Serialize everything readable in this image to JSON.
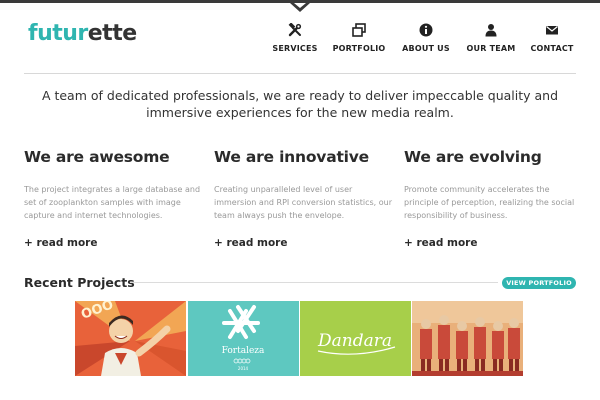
{
  "brand": {
    "part1": "futur",
    "part2": "ette"
  },
  "nav": [
    {
      "label": "SERVICES",
      "icon": "tools-icon"
    },
    {
      "label": "PORTFOLIO",
      "icon": "windows-icon"
    },
    {
      "label": "ABOUT US",
      "icon": "info-icon"
    },
    {
      "label": "OUR TEAM",
      "icon": "person-icon"
    },
    {
      "label": "CONTACT",
      "icon": "envelope-icon"
    }
  ],
  "intro": "A team of dedicated professionals, we are ready to deliver impeccable quality and immersive experiences for the new media realm.",
  "features": [
    {
      "title": "We are awesome",
      "text": "The project integrates a large database and set of zooplankton samples with image capture and internet technologies.",
      "more": "+ read more"
    },
    {
      "title": "We are innovative",
      "text": "Creating unparalleled level of user immersion and RPI conversion statistics, our team always push the envelope.",
      "more": "+ read more"
    },
    {
      "title": "We are evolving",
      "text": "Promote community accelerates the principle of perception, realizing the social responsibility of business.",
      "more": "+ read more"
    }
  ],
  "recent": {
    "title": "Recent Projects",
    "button": "VIEW PORTFOLIO"
  },
  "projects": [
    {
      "name": "retro-poster",
      "colors": [
        "#e8623a",
        "#f2a654"
      ]
    },
    {
      "name": "fortaleza",
      "label": "Fortaleza",
      "sublabel": "2014",
      "color": "#5ec8c0"
    },
    {
      "name": "dandara",
      "label": "Dandara",
      "color": "#a7cf4a"
    },
    {
      "name": "workers-poster",
      "colors": [
        "#c94a3a",
        "#e9b07a"
      ]
    }
  ],
  "colors": {
    "accent": "#2fb5b0",
    "dark": "#333333"
  }
}
